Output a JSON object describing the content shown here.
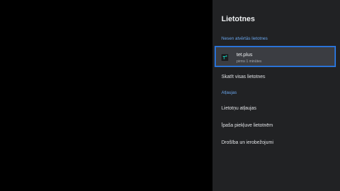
{
  "panel": {
    "title": "Lietotnes",
    "recent_header": "Nesen atvērtās lietotnes",
    "recent_apps": [
      {
        "name": "tet.plus",
        "subtitle": "pirms 1 minūtes",
        "icon": "tet-plus-app-icon"
      }
    ],
    "see_all": "Skatīt visas lietotnes",
    "permissions_header": "Atļaujas",
    "permission_items": [
      "Lietotņu atļaujas",
      "Īpaša piekļuve lietotnēm",
      "Drošība un ierobežojumi"
    ]
  },
  "colors": {
    "panel_bg": "#212224",
    "accent": "#6aa7ee",
    "focus_border": "#2a74d9",
    "focus_bg": "#3b3d42",
    "icon_accent": "#13c7b6"
  }
}
